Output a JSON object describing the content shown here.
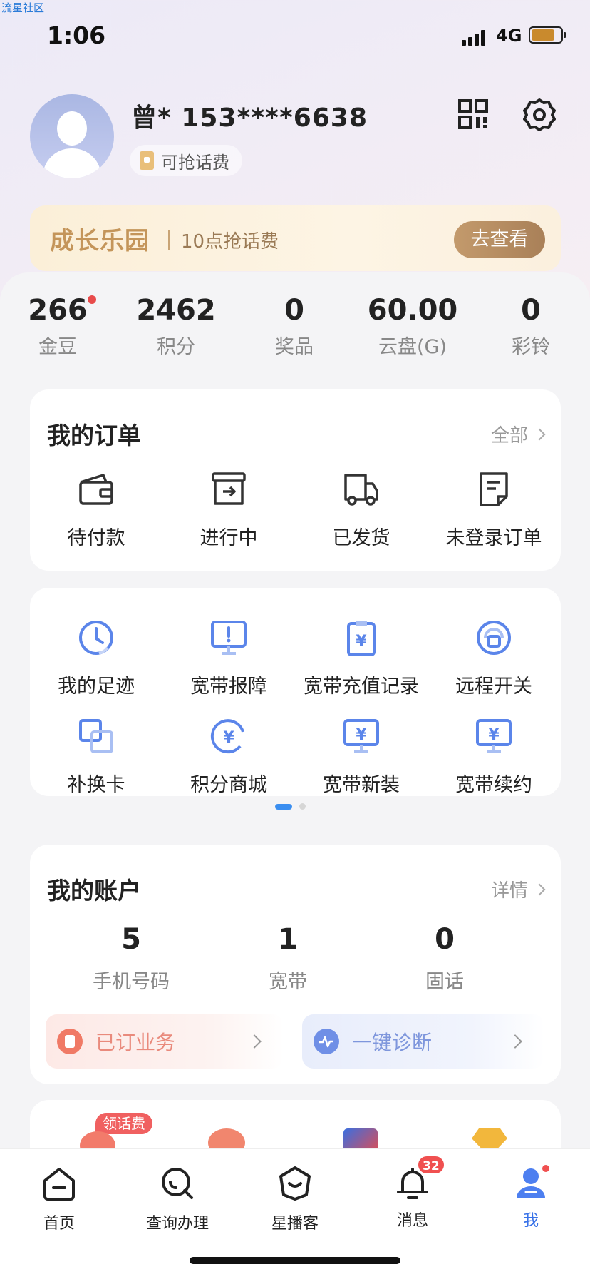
{
  "watermark": "流星社区",
  "status": {
    "time": "1:06",
    "network": "4G"
  },
  "profile": {
    "name": "曾*  153****6638",
    "badge": "可抢话费"
  },
  "banner": {
    "title": "成长乐园",
    "subtitle": "10点抢话费",
    "button": "去查看"
  },
  "stats": [
    {
      "value": "266",
      "label": "金豆"
    },
    {
      "value": "2462",
      "label": "积分"
    },
    {
      "value": "0",
      "label": "奖品"
    },
    {
      "value": "60.00",
      "label": "云盘(G)"
    },
    {
      "value": "0",
      "label": "彩铃"
    }
  ],
  "orders": {
    "title": "我的订单",
    "more": "全部",
    "items": [
      {
        "label": "待付款",
        "icon": "wallet-icon"
      },
      {
        "label": "进行中",
        "icon": "box-arrow-icon"
      },
      {
        "label": "已发货",
        "icon": "truck-icon"
      },
      {
        "label": "未登录订单",
        "icon": "receipt-icon"
      }
    ]
  },
  "services": {
    "items": [
      {
        "label": "我的足迹",
        "icon": "clock-icon"
      },
      {
        "label": "宽带报障",
        "icon": "monitor-alert-icon"
      },
      {
        "label": "宽带充值记录",
        "icon": "clipboard-yuan-icon"
      },
      {
        "label": "远程开关",
        "icon": "remote-switch-icon"
      },
      {
        "label": "补换卡",
        "icon": "card-swap-icon"
      },
      {
        "label": "积分商城",
        "icon": "points-yuan-icon"
      },
      {
        "label": "宽带新装",
        "icon": "monitor-yuan-icon"
      },
      {
        "label": "宽带续约",
        "icon": "monitor-yuan-icon"
      }
    ]
  },
  "account": {
    "title": "我的账户",
    "more": "详情",
    "items": [
      {
        "value": "5",
        "label": "手机号码"
      },
      {
        "value": "1",
        "label": "宽带"
      },
      {
        "value": "0",
        "label": "固话"
      }
    ],
    "subscribed": "已订业务",
    "diagnose": "一键诊断"
  },
  "promo_tag": "领话费",
  "tabs": [
    {
      "label": "首页",
      "icon": "home-icon"
    },
    {
      "label": "查询办理",
      "icon": "search-icon"
    },
    {
      "label": "星播客",
      "icon": "star-cast-icon"
    },
    {
      "label": "消息",
      "icon": "bell-icon",
      "badge": "32"
    },
    {
      "label": "我",
      "icon": "user-icon"
    }
  ],
  "colors": {
    "accent": "#3a73e8",
    "icon_blue": "#4f7fe8",
    "badge_red": "#f05050",
    "banner_gold": "#c4955a"
  }
}
